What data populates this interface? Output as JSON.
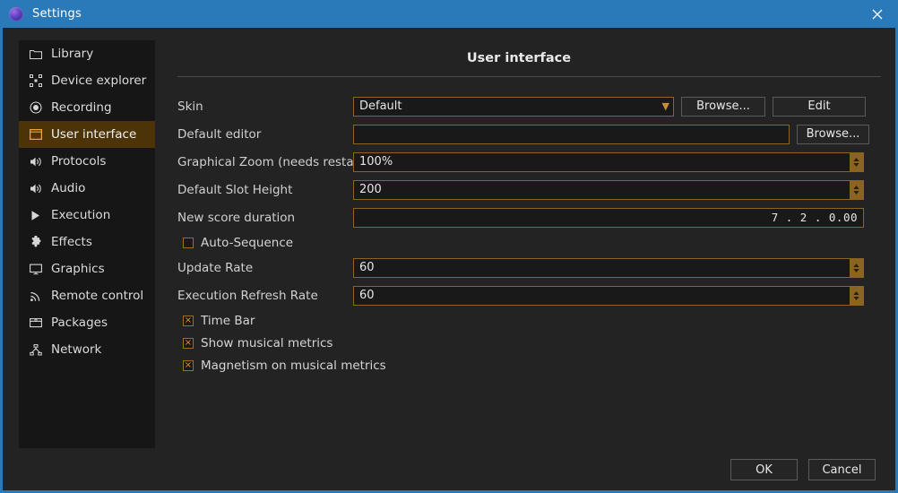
{
  "window": {
    "title": "Settings",
    "app_icon": "app-circle-icon",
    "close_icon": "close-icon",
    "accent_titlebar": "#2a7ab9",
    "accent_field_border": "#8a6420",
    "accent_selected": "#4d3408"
  },
  "sidebar": {
    "items": [
      {
        "label": "Library",
        "icon": "folder-icon",
        "selected": false
      },
      {
        "label": "Device explorer",
        "icon": "device-bounds-icon",
        "selected": false
      },
      {
        "label": "Recording",
        "icon": "record-circle-icon",
        "selected": false
      },
      {
        "label": "User interface",
        "icon": "window-icon",
        "selected": true
      },
      {
        "label": "Protocols",
        "icon": "speaker-icon",
        "selected": false
      },
      {
        "label": "Audio",
        "icon": "speaker-icon",
        "selected": false
      },
      {
        "label": "Execution",
        "icon": "play-icon",
        "selected": false
      },
      {
        "label": "Effects",
        "icon": "puzzle-icon",
        "selected": false
      },
      {
        "label": "Graphics",
        "icon": "monitor-icon",
        "selected": false
      },
      {
        "label": "Remote control",
        "icon": "signal-icon",
        "selected": false
      },
      {
        "label": "Packages",
        "icon": "package-icon",
        "selected": false
      },
      {
        "label": "Network",
        "icon": "network-nodes-icon",
        "selected": false
      }
    ]
  },
  "main": {
    "title": "User interface",
    "skin": {
      "label": "Skin",
      "value": "Default",
      "dropdown_icon": "chevron-down-icon",
      "browse_label": "Browse...",
      "edit_label": "Edit"
    },
    "default_editor": {
      "label": "Default editor",
      "value": "",
      "placeholder": "",
      "browse_label": "Browse..."
    },
    "graphical_zoom": {
      "label": "Graphical Zoom (needs restart)",
      "value": "100%",
      "spinner_icon": "spinner-updown-icon"
    },
    "default_slot_height": {
      "label": "Default Slot Height",
      "value": "200",
      "spinner_icon": "spinner-updown-icon"
    },
    "new_score_duration": {
      "label": "New score duration",
      "value": "7 . 2 . 0.00"
    },
    "auto_sequence": {
      "label": "Auto-Sequence",
      "checked": false,
      "mark": ""
    },
    "update_rate": {
      "label": "Update Rate",
      "value": "60",
      "spinner_icon": "spinner-updown-icon"
    },
    "execution_refresh_rate": {
      "label": "Execution Refresh Rate",
      "value": "60",
      "spinner_icon": "spinner-updown-icon"
    },
    "time_bar": {
      "label": "Time Bar",
      "checked": true,
      "mark": "×"
    },
    "show_musical_metrics": {
      "label": "Show musical metrics",
      "checked": true,
      "mark": "×"
    },
    "magnetism_on_musical_metrics": {
      "label": "Magnetism on musical metrics",
      "checked": true,
      "mark": "×"
    }
  },
  "footer": {
    "ok_label": "OK",
    "cancel_label": "Cancel"
  }
}
